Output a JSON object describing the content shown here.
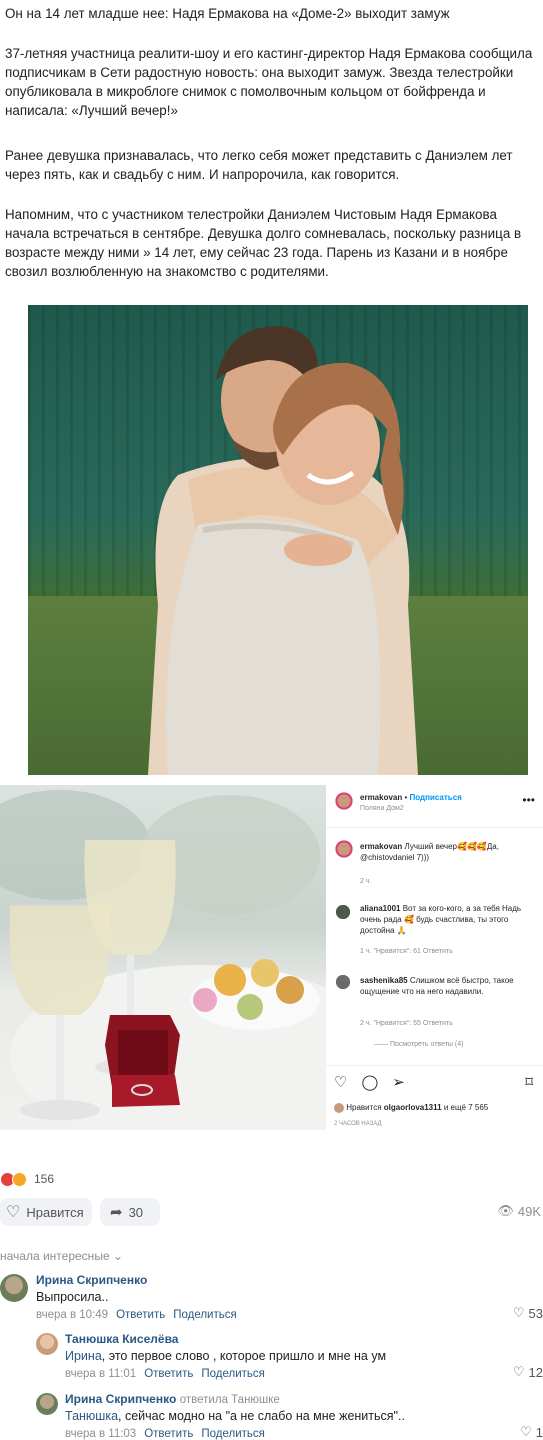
{
  "article": {
    "title": "Он на 14 лет младше нее: Надя Ермакова на «Доме-2» выходит замуж",
    "p1": "37-летняя участница реалити-шоу и его кастинг-директор Надя Ермакова сообщила подписчикам в Сети радостную новость: она выходит замуж. Звезда телестройки опубликовала в микроблоге снимок с помолвочным кольцом от бойфренда и написала: «Лучший вечер!»",
    "p2": "Ранее девушка признавалась, что легко себя может представить с Даниэлем лет через пять, как и свадьбу с ним. И напророчила, как говорится.",
    "p3": "Напомним, что с участником телестройки Даниэлем Чистовым Надя Ермакова начала встречаться в сентябре. Девушка долго сомневалась, поскольку разница в возрасте между ними » 14 лет, ему сейчас 23 года. Парень из Казани и в ноябре свозил возлюбленную на знакомство с родителями."
  },
  "instagram": {
    "username": "ermakovan",
    "follow": "Подписаться",
    "location": "Поляна Дом2",
    "caption_user": "ermakovan",
    "caption_text": "Лучший вечер🥰🥰🥰Да,",
    "caption_mention": "@chistovdaniel 7)))",
    "caption_time": "2 ч.",
    "c1_user": "aliana1001",
    "c1_text": "Вот за кого-кого, а за тебя Надь очень рада 🥰 будь счастлива, ты этого достойна 🙏",
    "c1_meta": "1 ч.   \"Нравится\": 61   Ответить",
    "c2_user": "sashenika85",
    "c2_text": "Слишком всё быстро, такое ощущение что на него надавили.",
    "c2_meta": "2 ч.   \"Нравится\": 55   Ответить",
    "view_replies": "—— Посмотреть ответы (4)",
    "likes_prefix": "Нравится",
    "likes_user": "olgaorlova1311",
    "likes_suffix": "и ещё 7 565",
    "time_ago": "2 ЧАСОВ НАЗАД"
  },
  "post": {
    "reactions_count": "156",
    "like_label": "Нравится",
    "share_count": "30",
    "views": "49K",
    "reaction_colors": [
      "#f5a623",
      "#e0413e"
    ]
  },
  "comments": {
    "sort_label": "начала интересные",
    "items": [
      {
        "name": "Ирина Скрипченко",
        "reply_to": "",
        "mention": "",
        "text": "Выпросила..",
        "time": "вчера в 10:49",
        "reply": "Ответить",
        "share": "Поделиться",
        "likes": "53"
      },
      {
        "name": "Танюшка Киселёва",
        "reply_to": "",
        "mention": "Ирина",
        "text": ", это первое слово , которое пришло и мне на ум",
        "time": "вчера в 11:01",
        "reply": "Ответить",
        "share": "Поделиться",
        "likes": "12"
      },
      {
        "name": "Ирина Скрипченко",
        "reply_to": "ответила Танюшке",
        "mention": "Танюшка",
        "text": ", сейчас модно на \"а не слабо на мне жениться\"..",
        "time": "вчера в 11:03",
        "reply": "Ответить",
        "share": "Поделиться",
        "likes": "1"
      }
    ]
  }
}
